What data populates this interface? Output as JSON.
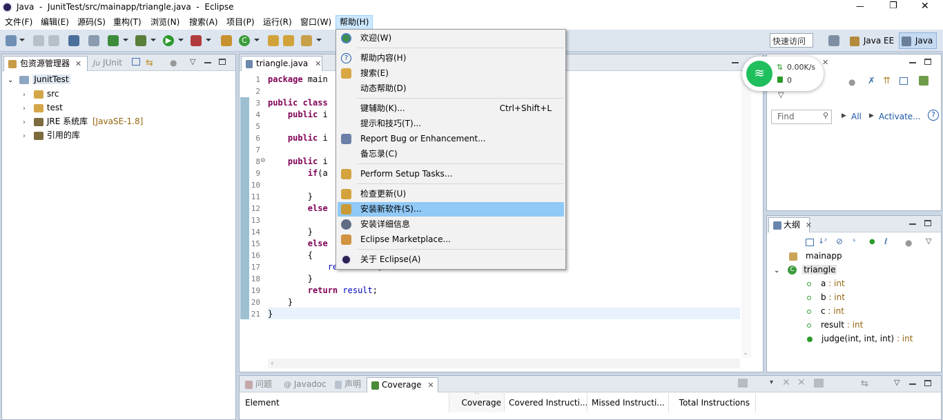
{
  "window": {
    "title": "Java  -  JunitTest/src/mainapp/triangle.java  -  Eclipse",
    "controls": {
      "minimize": "—",
      "maximize": "❐",
      "close": "✕"
    }
  },
  "menubar": {
    "items": [
      "文件(F)",
      "编辑(E)",
      "源码(S)",
      "重构(T)",
      "浏览(N)",
      "搜索(A)",
      "项目(P)",
      "运行(R)",
      "窗口(W)",
      "帮助(H)"
    ]
  },
  "toolbar": {
    "quick_access": "快速访问",
    "perspectives": [
      "Java EE",
      "Java"
    ]
  },
  "package_explorer": {
    "tabs": [
      "包资源管理器",
      "JUnit"
    ],
    "tree": [
      {
        "label": "JunitTest",
        "icon": "project-icon"
      },
      {
        "label": "src",
        "icon": "source-folder-icon"
      },
      {
        "label": "test",
        "icon": "source-folder-icon"
      },
      {
        "label": "JRE 系统库",
        "suffix": "[JavaSE-1.8]",
        "icon": "library-icon"
      },
      {
        "label": "引用的库",
        "icon": "library-icon"
      }
    ]
  },
  "editor": {
    "tab": "triangle.java",
    "lines": [
      {
        "n": "1",
        "text": "package main"
      },
      {
        "n": "2",
        "text": ""
      },
      {
        "n": "3",
        "text": "public class"
      },
      {
        "n": "4",
        "text": "    public i"
      },
      {
        "n": "5",
        "text": ""
      },
      {
        "n": "6",
        "text": "    public i"
      },
      {
        "n": "7",
        "text": ""
      },
      {
        "n": "8",
        "text": "    public i"
      },
      {
        "n": "9",
        "text": "        if(a"
      },
      {
        "n": "10",
        "text": ""
      },
      {
        "n": "11",
        "text": "        }"
      },
      {
        "n": "12",
        "text": "        else"
      },
      {
        "n": "13",
        "text": ""
      },
      {
        "n": "14",
        "text": "        }"
      },
      {
        "n": "15",
        "text": "        else"
      },
      {
        "n": "16",
        "text": "        {"
      },
      {
        "n": "17",
        "text": "            result = 4;"
      },
      {
        "n": "18",
        "text": "        }"
      },
      {
        "n": "19",
        "text": "        return result;"
      },
      {
        "n": "20",
        "text": "    }"
      },
      {
        "n": "21",
        "text": "}"
      }
    ]
  },
  "network_widget": {
    "speed": "0.00K/s",
    "count": "0"
  },
  "task_list": {
    "find_placeholder": "Find",
    "all_link": "All",
    "activate_link": "Activate..."
  },
  "outline": {
    "tab": "大纲",
    "items": [
      {
        "name": "mainapp",
        "type": ""
      },
      {
        "name": "triangle",
        "type": ""
      },
      {
        "name": "a",
        "type": " : int"
      },
      {
        "name": "b",
        "type": " : int"
      },
      {
        "name": "c",
        "type": " : int"
      },
      {
        "name": "result",
        "type": " : int"
      },
      {
        "name": "judge(int, int, int)",
        "type": " : int"
      }
    ]
  },
  "bottom_panel": {
    "tabs": [
      "问题",
      "Javadoc",
      "声明",
      "Coverage"
    ],
    "columns": [
      "Element",
      "Coverage",
      "Covered Instructi...",
      "Missed Instructi...",
      "Total Instructions"
    ]
  },
  "help_menu": {
    "items": [
      {
        "label": "欢迎(W)",
        "accel": ""
      },
      {
        "label": "帮助内容(H)",
        "accel": ""
      },
      {
        "label": "搜索(E)",
        "accel": ""
      },
      {
        "label": "动态帮助(D)",
        "accel": ""
      },
      {
        "label": "键辅助(K)...",
        "accel": "Ctrl+Shift+L"
      },
      {
        "label": "提示和技巧(T)...",
        "accel": ""
      },
      {
        "label": "Report Bug or Enhancement...",
        "accel": ""
      },
      {
        "label": "备忘录(C)",
        "accel": ""
      },
      {
        "label": "Perform Setup Tasks...",
        "accel": ""
      },
      {
        "label": "检查更新(U)",
        "accel": ""
      },
      {
        "label": "安装新软件(S)...",
        "accel": ""
      },
      {
        "label": "安装详细信息",
        "accel": ""
      },
      {
        "label": "Eclipse Marketplace...",
        "accel": ""
      },
      {
        "label": "关于 Eclipse(A)",
        "accel": ""
      }
    ]
  },
  "colors": {
    "highlight": "#91c9f7",
    "accent": "#0078d7"
  }
}
